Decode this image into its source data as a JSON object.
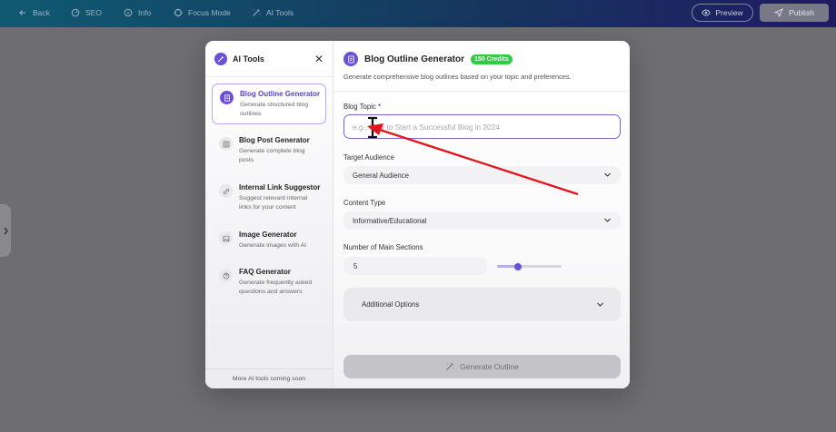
{
  "topbar": {
    "back": "Back",
    "seo": "SEO",
    "info": "Info",
    "focus_mode": "Focus Mode",
    "ai_tools": "AI Tools",
    "preview": "Preview",
    "publish": "Publish"
  },
  "panel": {
    "title": "AI Tools",
    "footer": "More AI tools coming soon",
    "tools": [
      {
        "title": "Blog Outline Generator",
        "desc": "Generate structured blog outlines",
        "icon": "document-icon"
      },
      {
        "title": "Blog Post Generator",
        "desc": "Generate complete blog posts",
        "icon": "article-icon"
      },
      {
        "title": "Internal Link Suggestor",
        "desc": "Suggest relevant internal links for your content",
        "icon": "link-icon"
      },
      {
        "title": "Image Generator",
        "desc": "Generate images with AI",
        "icon": "image-icon"
      },
      {
        "title": "FAQ Generator",
        "desc": "Generate frequently asked questions and answers",
        "icon": "question-icon"
      }
    ]
  },
  "form": {
    "title": "Blog Outline Generator",
    "credits": "150 Credits",
    "subtitle": "Generate comprehensive blog outlines based on your topic and preferences.",
    "topic_label": "Blog Topic *",
    "topic_placeholder": "e.g., How to Start a Successful Blog in 2024",
    "audience_label": "Target Audience",
    "audience_value": "General Audience",
    "content_label": "Content Type",
    "content_value": "Informative/Educational",
    "sections_label": "Number of Main Sections",
    "sections_value": "5",
    "sections_slider_fraction": 0.33,
    "additional_label": "Additional Options",
    "generate_label": "Generate Outline"
  },
  "colors": {
    "accent": "#6b4fd8",
    "credits": "#2ecc40",
    "annotation_arrow": "#e3141b"
  }
}
